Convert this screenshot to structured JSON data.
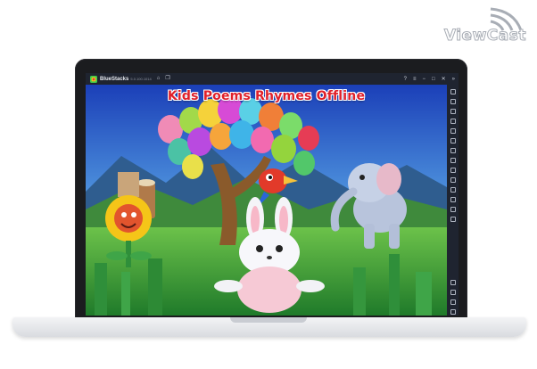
{
  "watermark": {
    "brand": "ViewCast"
  },
  "emulator": {
    "app_name": "BlueStacks",
    "version": "5.0.100.1014"
  },
  "game": {
    "title": "Kids Poems Rhymes Offline"
  },
  "colors": {
    "sky_top": "#1b3fb8",
    "sky_bottom": "#5aa7e6",
    "grass": "#3aa63a",
    "title_red": "#e0202a",
    "chrome": "#1f2430"
  }
}
